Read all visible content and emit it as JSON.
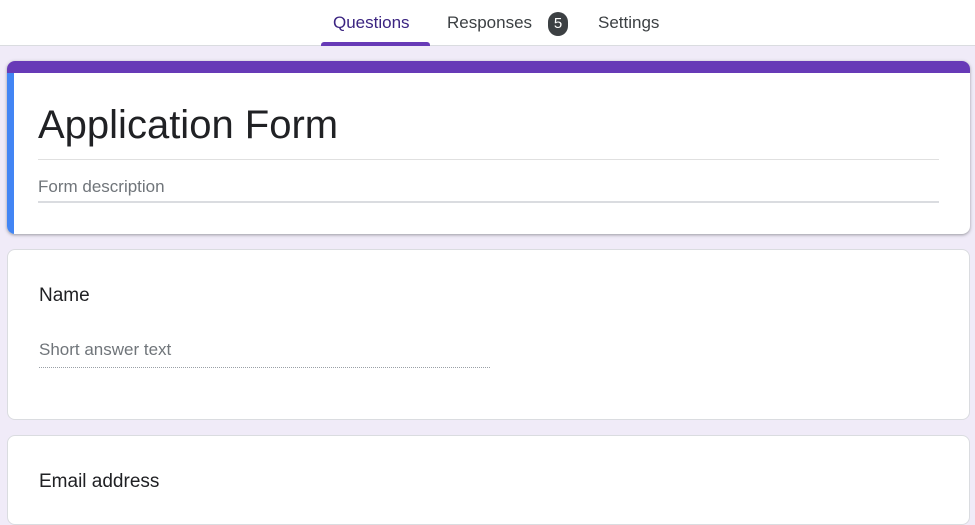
{
  "tabs": {
    "questions": "Questions",
    "responses": "Responses",
    "responses_count": "5",
    "settings": "Settings"
  },
  "form": {
    "title": "Application Form",
    "description_placeholder": "Form description"
  },
  "questions": [
    {
      "title": "Name",
      "answer_placeholder": "Short answer text"
    },
    {
      "title": "Email address"
    }
  ],
  "colors": {
    "accent": "#673ab7",
    "active_tab_text": "#3b2481",
    "left_accent": "#4285f4",
    "background": "#f0ebf8"
  }
}
